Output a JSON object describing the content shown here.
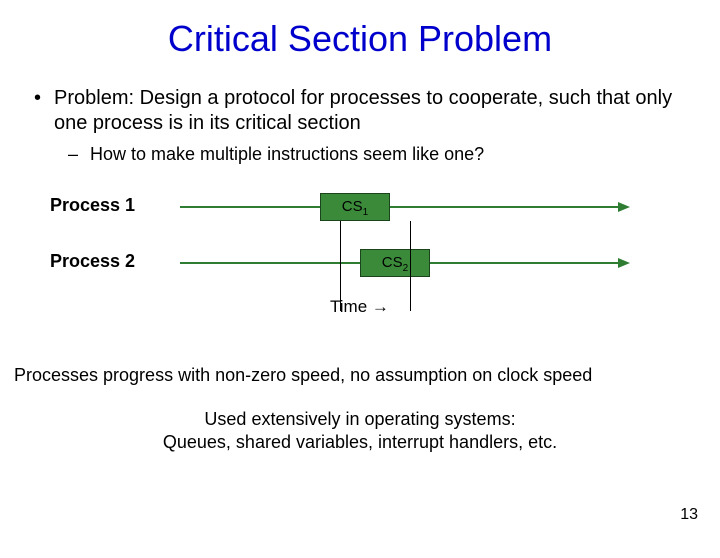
{
  "title": "Critical Section Problem",
  "bullet": "Problem: Design a protocol for processes to cooperate, such that only one process is in its critical section",
  "subbullet": "How to make multiple instructions seem like one?",
  "diagram": {
    "proc1_label": "Process 1",
    "proc2_label": "Process 2",
    "cs1_label": "CS",
    "cs1_sub": "1",
    "cs2_label": "CS",
    "cs2_sub": "2",
    "time_label": "Time →"
  },
  "footer1": "Processes progress with non-zero speed, no assumption on clock speed",
  "footer2_line1": "Used extensively in operating systems:",
  "footer2_line2": "Queues, shared variables, interrupt handlers, etc.",
  "page_number": "13"
}
